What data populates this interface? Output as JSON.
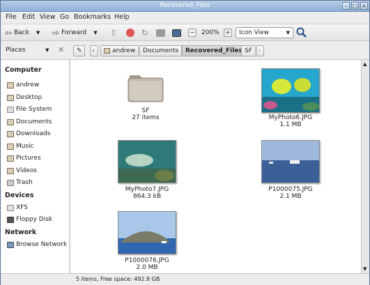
{
  "window": {
    "title": "Recovered_Files"
  },
  "menu": [
    "File",
    "Edit",
    "View",
    "Go",
    "Bookmarks",
    "Help"
  ],
  "toolbar": {
    "back": "Back",
    "forward": "Forward",
    "zoom": "200%",
    "view_mode": "Icon View"
  },
  "location": {
    "places_label": "Places",
    "crumbs": [
      "andrew",
      "Documents",
      "Recovered_Files",
      "SF"
    ],
    "active_crumb": "Recovered_Files"
  },
  "sidebar": {
    "computer_header": "Computer",
    "computer_items": [
      "andrew",
      "Desktop",
      "File System",
      "Documents",
      "Downloads",
      "Music",
      "Pictures",
      "Videos",
      "Trash"
    ],
    "devices_header": "Devices",
    "devices_items": [
      "XFS",
      "Floppy Disk"
    ],
    "network_header": "Network",
    "network_items": [
      "Browse Network"
    ]
  },
  "files": [
    {
      "name": "SF",
      "info": "27 items",
      "kind": "folder"
    },
    {
      "name": "MyPhoto6.JPG",
      "info": "1.1 MB",
      "kind": "fish-yellow"
    },
    {
      "name": "MyPhoto7.JPG",
      "info": "864.3 kB",
      "kind": "fish-green"
    },
    {
      "name": "P1000075.JPG",
      "info": "2.1 MB",
      "kind": "boat"
    },
    {
      "name": "P1000076.JPG",
      "info": "2.0 MB",
      "kind": "island"
    }
  ],
  "status": {
    "text": "5 items, Free space: 492.8 GB"
  }
}
